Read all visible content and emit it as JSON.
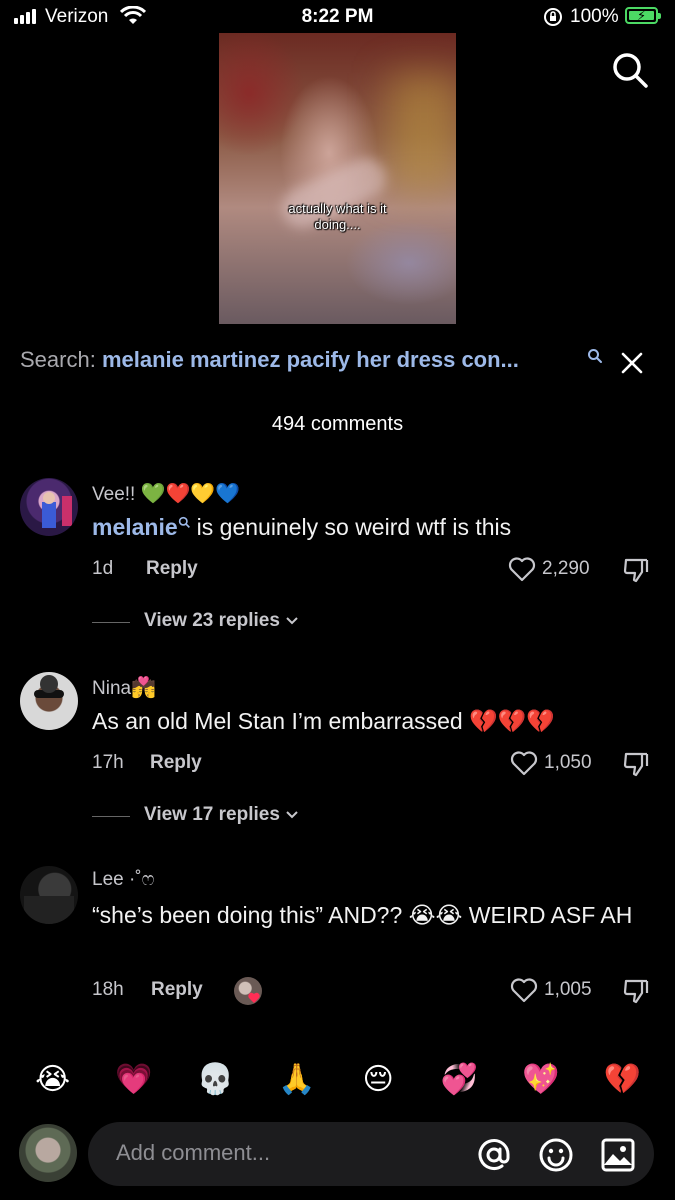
{
  "status_bar": {
    "carrier": "Verizon",
    "time": "8:22 PM",
    "battery_percent": "100%",
    "battery_level": 1.0
  },
  "video": {
    "caption_line1": "actually what is it",
    "caption_line2": "doing...."
  },
  "search": {
    "label": "Search:",
    "query": "melanie martinez pacify her dress con..."
  },
  "comments_count": "494 comments",
  "comments": [
    {
      "username": "Vee!!",
      "username_emoji": "💚❤️💛💙",
      "mention": "melanie",
      "text": "is genuinely so weird wtf is this",
      "age": "1d",
      "reply_label": "Reply",
      "likes": "2,290",
      "view_replies": "View 23 replies"
    },
    {
      "username": "Nina",
      "username_emoji": "💏",
      "text": "As an old Mel Stan I’m embarrassed 💔💔💔",
      "age": "17h",
      "reply_label": "Reply",
      "likes": "1,050",
      "view_replies": "View 17 replies"
    },
    {
      "username": "Lee",
      "username_suffix": "·˚ෆ",
      "text": "“she’s been doing this” AND?? 😭😭 WEIRD ASF AH",
      "age": "18h",
      "reply_label": "Reply",
      "likes": "1,005"
    }
  ],
  "emoji_bar": [
    "😭",
    "💗",
    "💀",
    "🙏",
    "😔",
    "💞",
    "💖",
    "💔"
  ],
  "comment_input": {
    "placeholder": "Add comment..."
  },
  "icons": {
    "search": "search-icon",
    "close": "close-icon",
    "heart": "heart-icon",
    "dislike": "thumbs-down-icon",
    "mention": "at-icon",
    "emoji": "smiley-icon",
    "image": "image-icon"
  },
  "colors": {
    "background": "#000000",
    "accent_link": "#9db9e8",
    "muted_text": "#c7c7cc",
    "input_bg": "#1c1c1e",
    "battery": "#4cd964"
  }
}
